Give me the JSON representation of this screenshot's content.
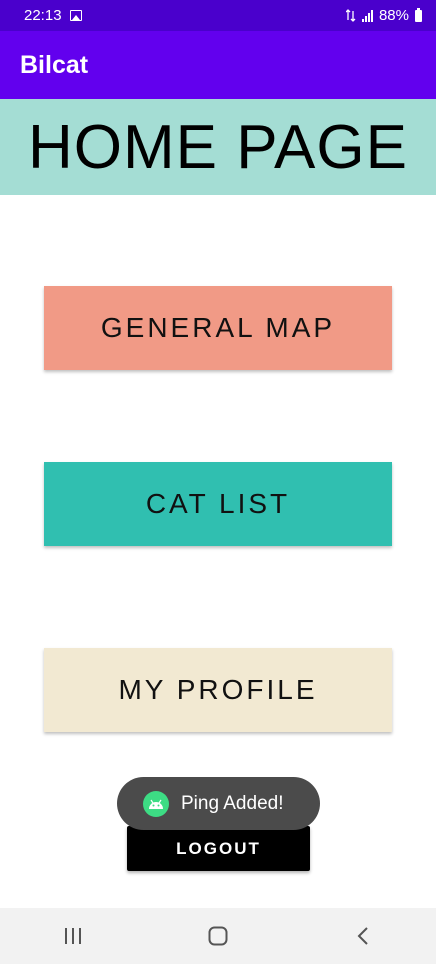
{
  "status_bar": {
    "time": "22:13",
    "battery": "88%"
  },
  "app_bar": {
    "title": "Bilcat"
  },
  "banner": {
    "title": "HOME PAGE"
  },
  "buttons": {
    "general_map": "GENERAL MAP",
    "cat_list": "CAT LIST",
    "my_profile": "MY PROFILE",
    "logout": "LOGOUT"
  },
  "toast": {
    "message": "Ping Added!"
  },
  "colors": {
    "status_bar": "#4a00cc",
    "app_bar": "#6200ee",
    "banner": "#a4ddd4",
    "general_map": "#f19a86",
    "cat_list": "#30bfb0",
    "my_profile": "#f2e9d2",
    "logout": "#000000"
  },
  "icons": [
    "image-icon",
    "data-arrows-icon",
    "signal-icon",
    "battery-icon",
    "android-icon",
    "recents-icon",
    "home-icon",
    "back-icon"
  ]
}
